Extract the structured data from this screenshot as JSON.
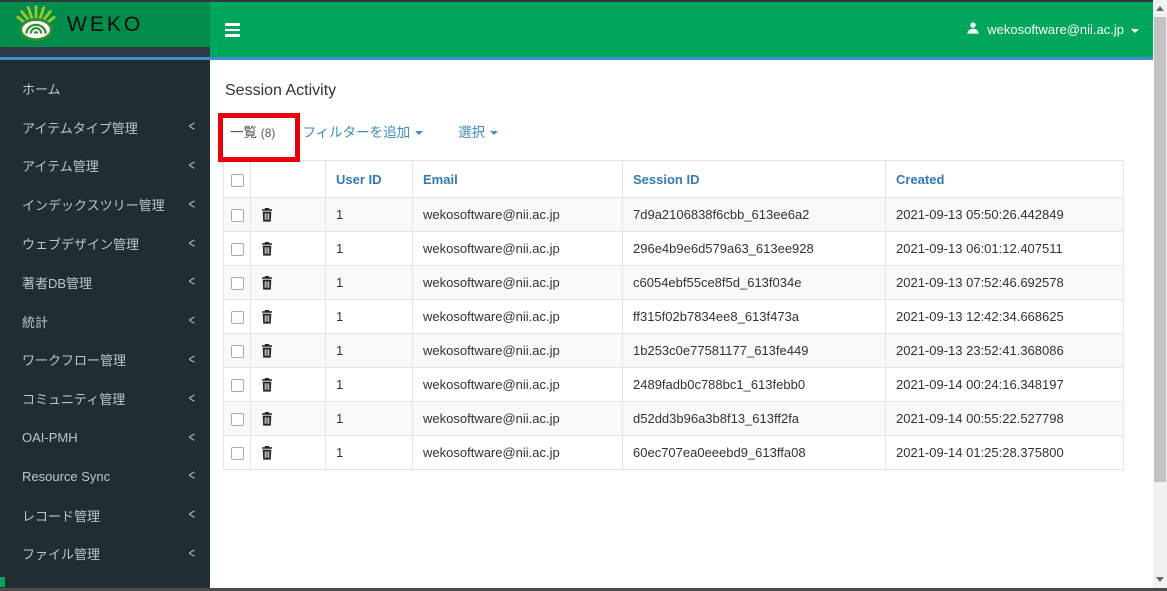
{
  "header": {
    "logo_text": "WEKO",
    "user_email": "wekosoftware@nii.ac.jp"
  },
  "sidebar": {
    "items": [
      {
        "label": "ホーム",
        "has_submenu": false
      },
      {
        "label": "アイテムタイプ管理",
        "has_submenu": true
      },
      {
        "label": "アイテム管理",
        "has_submenu": true
      },
      {
        "label": "インデックスツリー管理",
        "has_submenu": true
      },
      {
        "label": "ウェブデザイン管理",
        "has_submenu": true
      },
      {
        "label": "著者DB管理",
        "has_submenu": true
      },
      {
        "label": "統計",
        "has_submenu": true
      },
      {
        "label": "ワークフロー管理",
        "has_submenu": true
      },
      {
        "label": "コミュニティ管理",
        "has_submenu": true
      },
      {
        "label": "OAI-PMH",
        "has_submenu": true
      },
      {
        "label": "Resource Sync",
        "has_submenu": true
      },
      {
        "label": "レコード管理",
        "has_submenu": true
      },
      {
        "label": "ファイル管理",
        "has_submenu": true
      }
    ]
  },
  "main": {
    "title": "Session Activity",
    "toolbar": {
      "list_label": "一覧",
      "list_count": "(8)",
      "add_filter_label": "フィルターを追加",
      "select_label": "選択"
    },
    "table": {
      "headers": [
        "",
        "",
        "User ID",
        "Email",
        "Session ID",
        "Created"
      ],
      "rows": [
        {
          "user_id": "1",
          "email": "wekosoftware@nii.ac.jp",
          "session_id": "7d9a2106838f6cbb_613ee6a2",
          "created": "2021-09-13 05:50:26.442849"
        },
        {
          "user_id": "1",
          "email": "wekosoftware@nii.ac.jp",
          "session_id": "296e4b9e6d579a63_613ee928",
          "created": "2021-09-13 06:01:12.407511"
        },
        {
          "user_id": "1",
          "email": "wekosoftware@nii.ac.jp",
          "session_id": "c6054ebf55ce8f5d_613f034e",
          "created": "2021-09-13 07:52:46.692578"
        },
        {
          "user_id": "1",
          "email": "wekosoftware@nii.ac.jp",
          "session_id": "ff315f02b7834ee8_613f473a",
          "created": "2021-09-13 12:42:34.668625"
        },
        {
          "user_id": "1",
          "email": "wekosoftware@nii.ac.jp",
          "session_id": "1b253c0e77581177_613fe449",
          "created": "2021-09-13 23:52:41.368086"
        },
        {
          "user_id": "1",
          "email": "wekosoftware@nii.ac.jp",
          "session_id": "2489fadb0c788bc1_613febb0",
          "created": "2021-09-14 00:24:16.348197"
        },
        {
          "user_id": "1",
          "email": "wekosoftware@nii.ac.jp",
          "session_id": "d52dd3b96a3b8f13_613ff2fa",
          "created": "2021-09-14 00:55:22.527798"
        },
        {
          "user_id": "1",
          "email": "wekosoftware@nii.ac.jp",
          "session_id": "60ec707ea0eeebd9_613ffa08",
          "created": "2021-09-14 01:25:28.375800"
        }
      ]
    }
  },
  "annotation": {
    "shape": "red-box",
    "target": "list-tab"
  },
  "colors": {
    "navbar_green": "#00a65a",
    "logo_green": "#008d4c",
    "sidebar_dark": "#222d32",
    "link_blue": "#337ab7",
    "blue_line": "#3e8ecc",
    "annotation_red": "#e8000d"
  }
}
